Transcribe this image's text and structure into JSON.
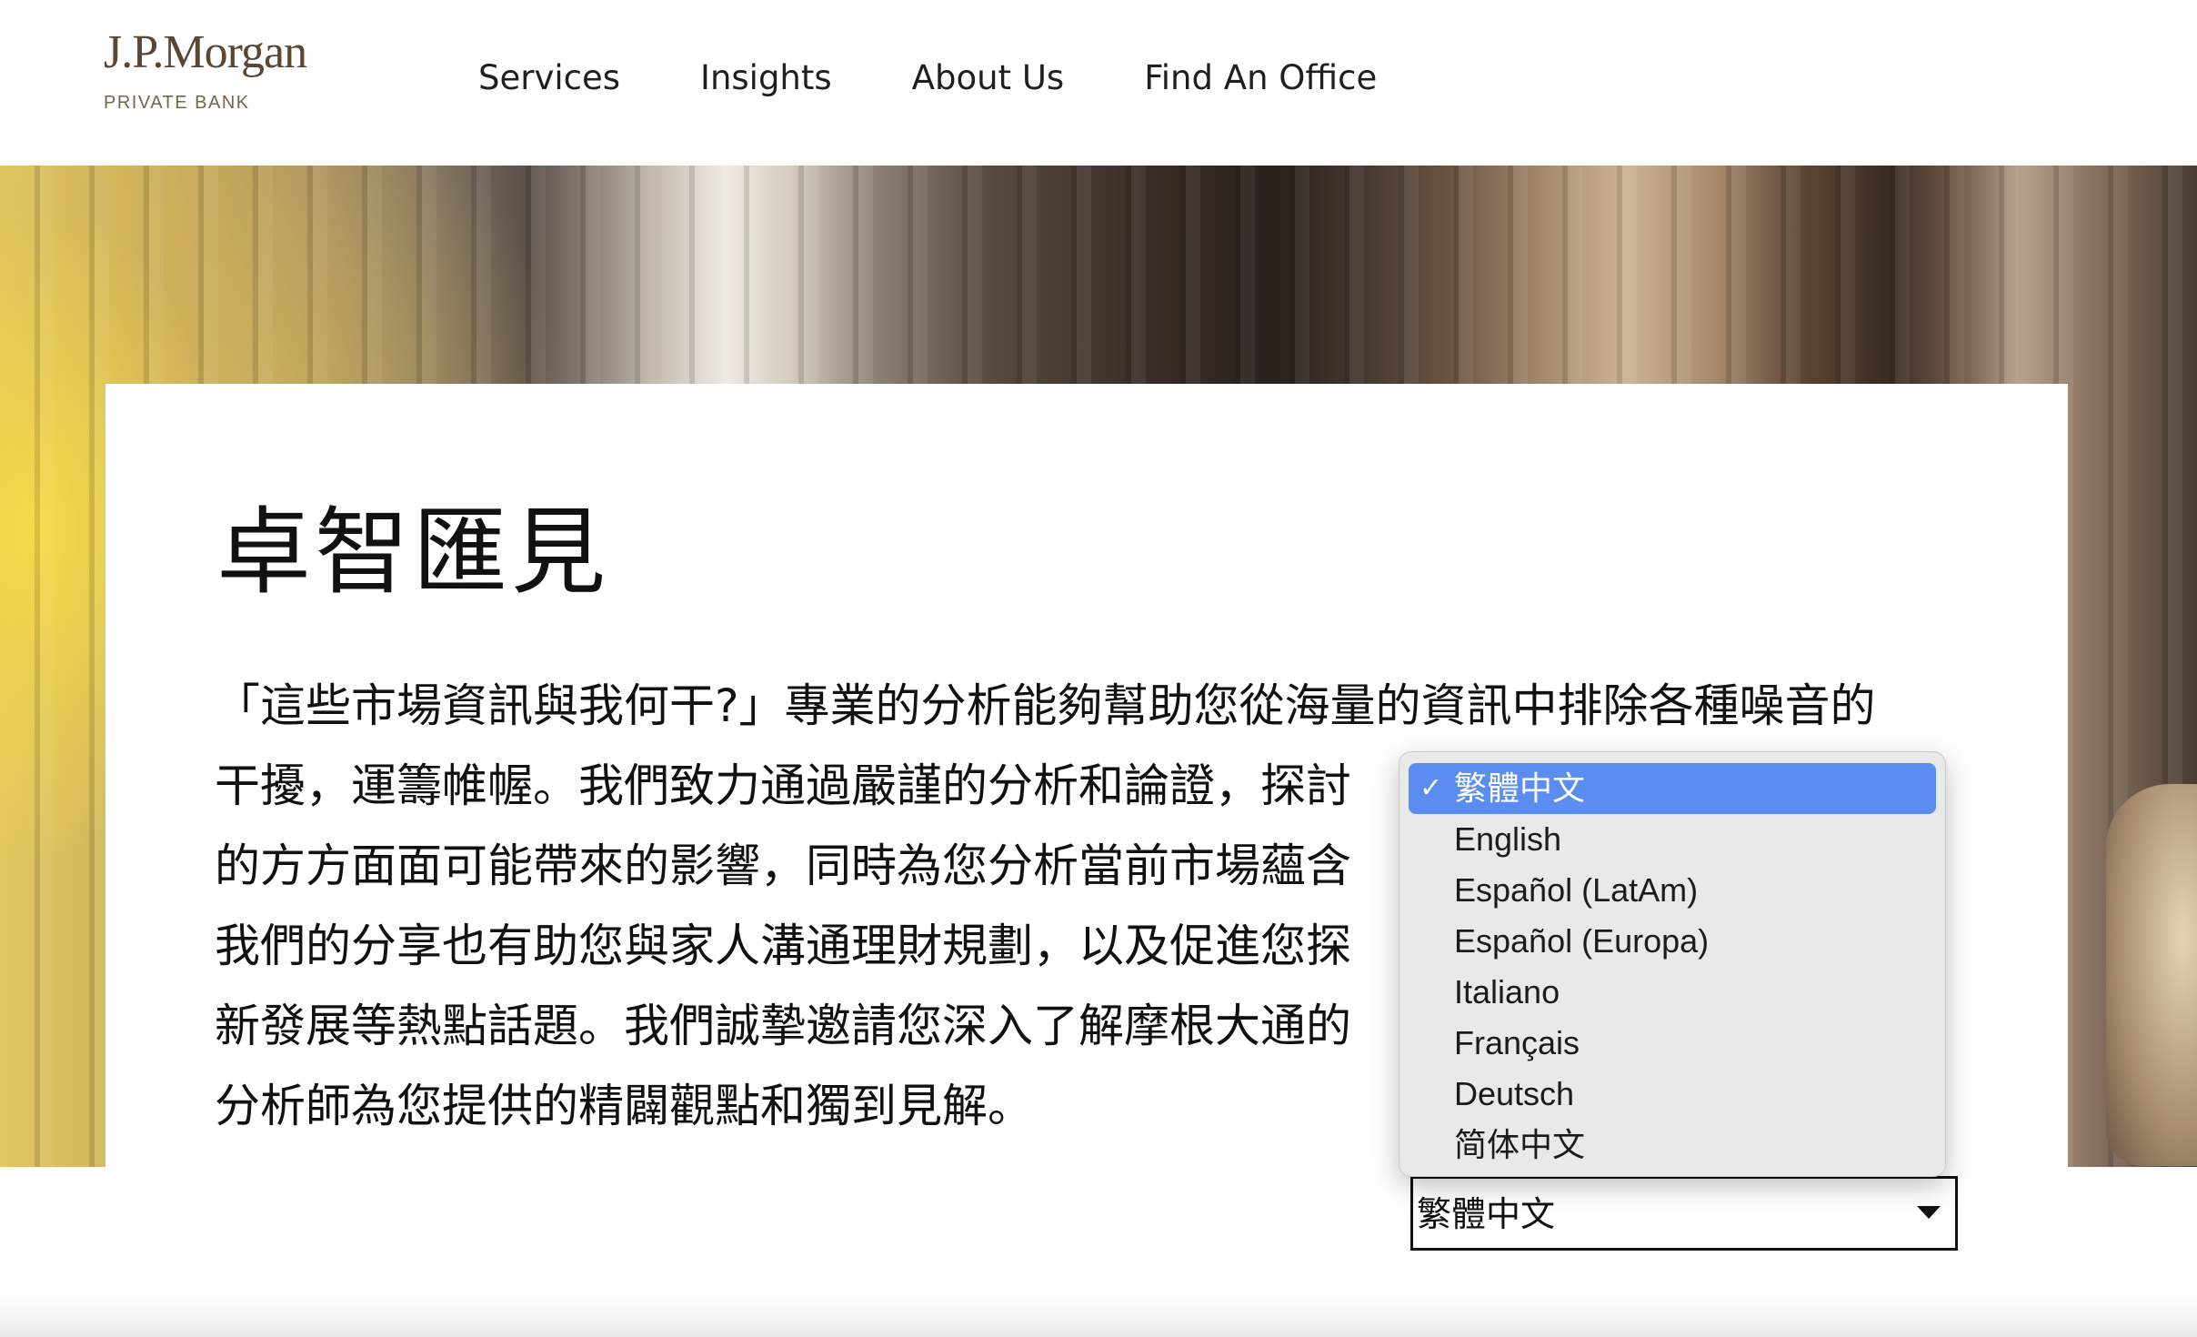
{
  "brand": {
    "name": "J.P.Morgan",
    "sub": "PRIVATE BANK"
  },
  "nav": {
    "items": [
      "Services",
      "Insights",
      "About Us",
      "Find An Office"
    ]
  },
  "page": {
    "title": "卓智匯見",
    "intro_lines": [
      "「這些市場資訊與我何干?」專業的分析能夠幫助您從海量的資訊中排除各種噪音的",
      "干擾，運籌帷幄。我們致力通過嚴謹的分析和論證，探討",
      "的方方面面可能帶來的影響，同時為您分析當前市場蘊含",
      "我們的分享也有助您與家人溝通理財規劃，以及促進您探",
      "新發展等熱點話題。我們誠摯邀請您深入了解摩根大通的",
      "分析師為您提供的精闢觀點和獨到見解。"
    ]
  },
  "language_select": {
    "value": "繁體中文",
    "options": [
      "繁體中文",
      "English",
      "Español (LatAm)",
      "Español (Europa)",
      "Italiano",
      "Français",
      "Deutsch",
      "简体中文"
    ],
    "selected_index": 0,
    "check_icon": "checkmark-icon",
    "selected_color": "#5b8cf0"
  }
}
